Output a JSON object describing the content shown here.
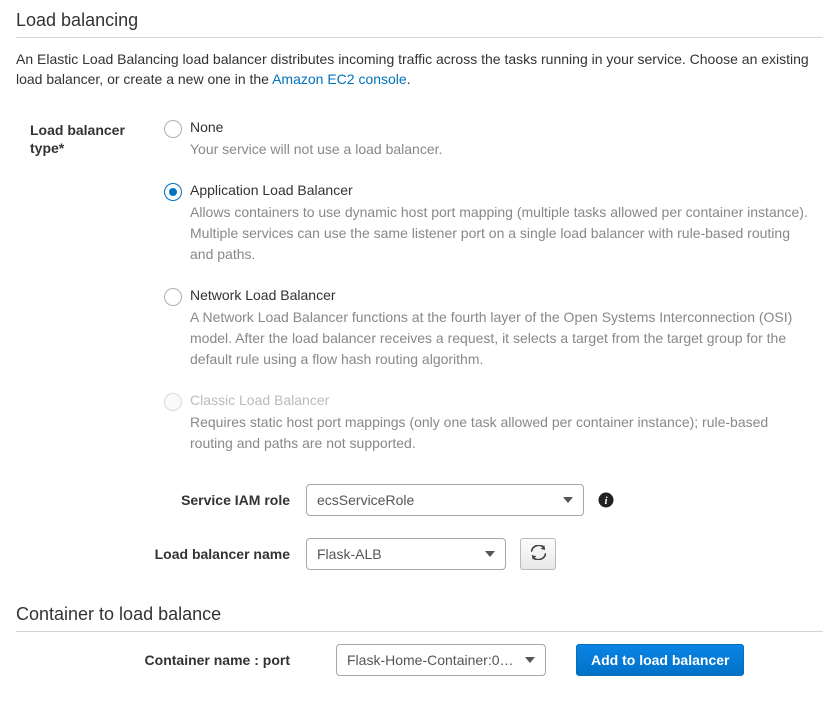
{
  "sections": {
    "load_balancing_title": "Load balancing",
    "intro_prefix": "An Elastic Load Balancing load balancer distributes incoming traffic across the tasks running in your service. Choose an existing load balancer, or create a new one in the ",
    "intro_link": "Amazon EC2 console",
    "intro_suffix": ".",
    "container_title": "Container to load balance"
  },
  "lb_type": {
    "label": "Load balancer type*",
    "options": [
      {
        "title": "None",
        "desc": "Your service will not use a load balancer.",
        "selected": false,
        "disabled": false
      },
      {
        "title": "Application Load Balancer",
        "desc": "Allows containers to use dynamic host port mapping (multiple tasks allowed per container instance). Multiple services can use the same listener port on a single load balancer with rule-based routing and paths.",
        "selected": true,
        "disabled": false
      },
      {
        "title": "Network Load Balancer",
        "desc": "A Network Load Balancer functions at the fourth layer of the Open Systems Interconnection (OSI) model. After the load balancer receives a request, it selects a target from the target group for the default rule using a flow hash routing algorithm.",
        "selected": false,
        "disabled": false
      },
      {
        "title": "Classic Load Balancer",
        "desc": "Requires static host port mappings (only one task allowed per container instance); rule-based routing and paths are not supported.",
        "selected": false,
        "disabled": true
      }
    ]
  },
  "fields": {
    "iam_role_label": "Service IAM role",
    "iam_role_value": "ecsServiceRole",
    "lb_name_label": "Load balancer name",
    "lb_name_value": "Flask-ALB",
    "container_label": "Container name : port",
    "container_value": "Flask-Home-Container:0…",
    "add_button": "Add to load balancer"
  }
}
